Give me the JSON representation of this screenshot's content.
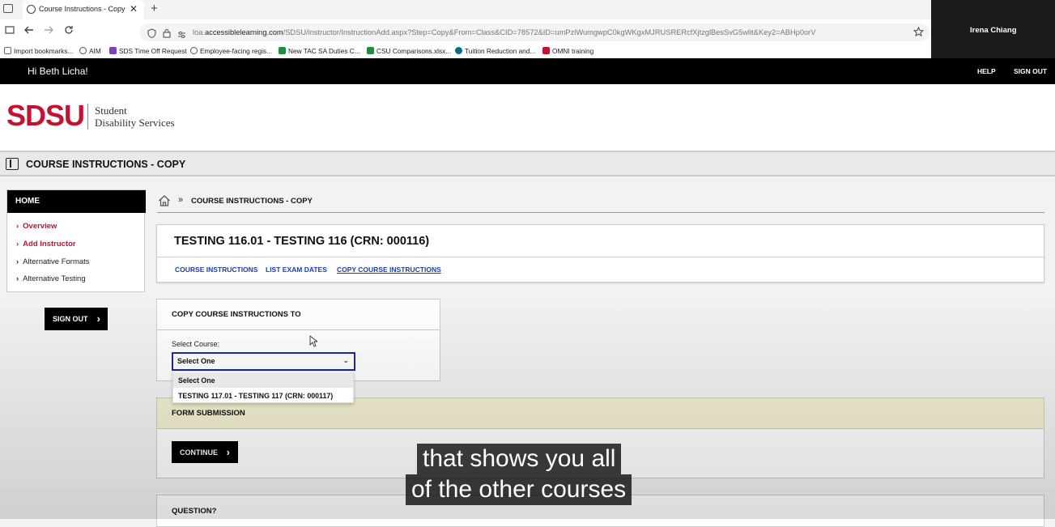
{
  "browser": {
    "tab_title": "Course Instructions - Copy",
    "tab_close": "✕",
    "new_tab": "+",
    "url_prefix": "loa.",
    "url_domain": "accessiblelearning.com",
    "url_rest": "/SDSU/instructor/InstructionAdd.aspx?Step=Copy&From=Class&CID=78572&ID=umPzlWumgwpC0kgWKgxMJRUSRERcfXjtzglBesSvG5wlit&Key2=ABHp0orV",
    "bookmarks": [
      {
        "label": "Import bookmarks...",
        "color": "#666666"
      },
      {
        "label": "AIM",
        "color": "#555555"
      },
      {
        "label": "SDS Time Off Request",
        "color": "#7b3fbf"
      },
      {
        "label": "Employee-facing regis...",
        "color": "#555555"
      },
      {
        "label": "New TAC SA Duties C...",
        "color": "#1e8e3e"
      },
      {
        "label": "CSU Comparisons.xlsx...",
        "color": "#1e8e3e"
      },
      {
        "label": "Tuition Reduction and...",
        "color": "#0b6a8a"
      },
      {
        "label": "OMNI training",
        "color": "#c41230"
      }
    ]
  },
  "video": {
    "participant": "Irena Chiang"
  },
  "topbar": {
    "greeting": "Hi Beth Licha!",
    "help": "HELP",
    "signout": "SIGN OUT"
  },
  "header": {
    "logo": "SDSU",
    "dept_line1": "Student",
    "dept_line2": "Disability Services"
  },
  "pagebar": {
    "title": "COURSE INSTRUCTIONS - COPY"
  },
  "sidebar": {
    "heading": "HOME",
    "items": [
      {
        "label": "Overview"
      },
      {
        "label": "Add Instructor"
      },
      {
        "label": "Alternative Formats"
      },
      {
        "label": "Alternative Testing"
      }
    ],
    "signout": "SIGN OUT"
  },
  "breadcrumb": {
    "sep": "»",
    "current": "COURSE INSTRUCTIONS - COPY"
  },
  "course": {
    "title": "TESTING 116.01 - TESTING 116 (CRN: 000116)",
    "links": [
      "COURSE INSTRUCTIONS",
      "LIST EXAM DATES",
      "COPY COURSE INSTRUCTIONS"
    ]
  },
  "copy": {
    "heading": "COPY COURSE INSTRUCTIONS TO",
    "select_label": "Select Course:",
    "selected": "Select One",
    "options": [
      "Select One",
      "TESTING 117.01 - TESTING 117 (CRN: 000117)"
    ]
  },
  "form": {
    "heading": "FORM SUBMISSION",
    "continue": "CONTINUE"
  },
  "question": {
    "heading": "QUESTION?"
  },
  "captions": {
    "line1": "that shows you all",
    "line2": "of the other courses"
  }
}
